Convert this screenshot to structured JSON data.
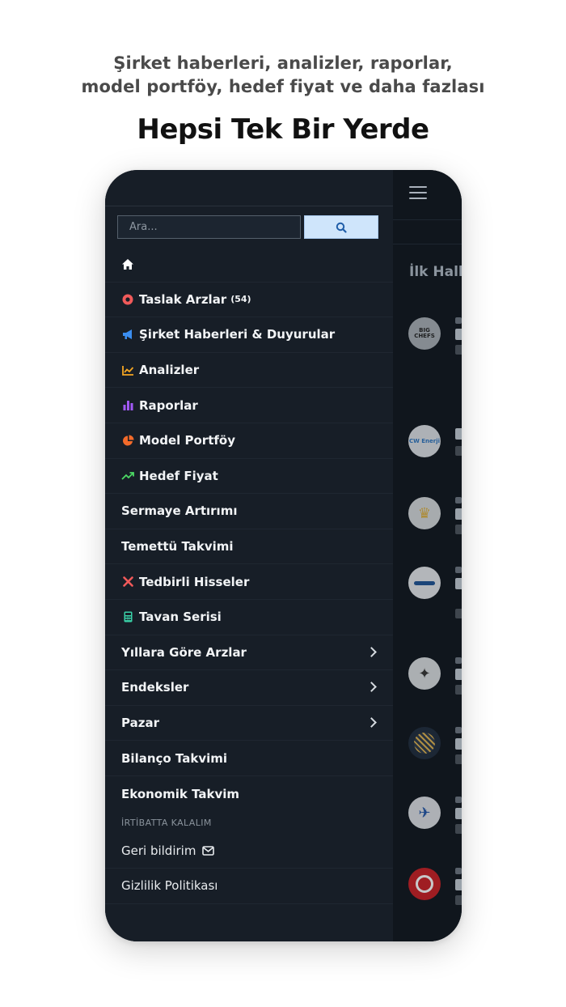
{
  "promo": {
    "subtitle_line1": "Şirket haberleri, analizler, raporlar,",
    "subtitle_line2": "model portföy, hedef fiyat ve daha fazlası",
    "title": "Hepsi Tek Bir Yerde"
  },
  "drawer": {
    "search": {
      "placeholder": "Ara..."
    },
    "menu": [
      {
        "label": "Taslak Arzlar",
        "count": "(54)",
        "icon": "circle-dot-icon",
        "color": "#f05a5a"
      },
      {
        "label": "Şirket Haberleri & Duyurular",
        "icon": "megaphone-icon",
        "color": "#3b8ef0"
      },
      {
        "label": "Analizler",
        "icon": "line-chart-icon",
        "color": "#f5a623"
      },
      {
        "label": "Raporlar",
        "icon": "bar-chart-icon",
        "color": "#a259f7"
      },
      {
        "label": "Model Portföy",
        "icon": "pie-chart-icon",
        "color": "#f26a2a"
      },
      {
        "label": "Hedef Fiyat",
        "icon": "trend-up-icon",
        "color": "#4cd964"
      },
      {
        "label": "Sermaye Artırımı"
      },
      {
        "label": "Temettü Takvimi"
      },
      {
        "label": "Tedbirli Hisseler",
        "icon": "x-icon",
        "color": "#f05a5a"
      },
      {
        "label": "Tavan Serisi",
        "icon": "calculator-icon",
        "color": "#3ad1a8"
      },
      {
        "label": "Yıllara Göre Arzlar"
      },
      {
        "label": "Endeksler"
      },
      {
        "label": "Pazar"
      },
      {
        "label": "Bilanço Takvimi"
      },
      {
        "label": "Ekonomik Takvim"
      }
    ],
    "contact_label": "İRTİBATTA KALALIM",
    "feedback_label": "Geri bildirim",
    "privacy_label": "Gizlilik Politikası"
  },
  "main": {
    "section_title": "İlk Halk",
    "logos": [
      "BIG CHEFS",
      "CW Enerji"
    ]
  }
}
